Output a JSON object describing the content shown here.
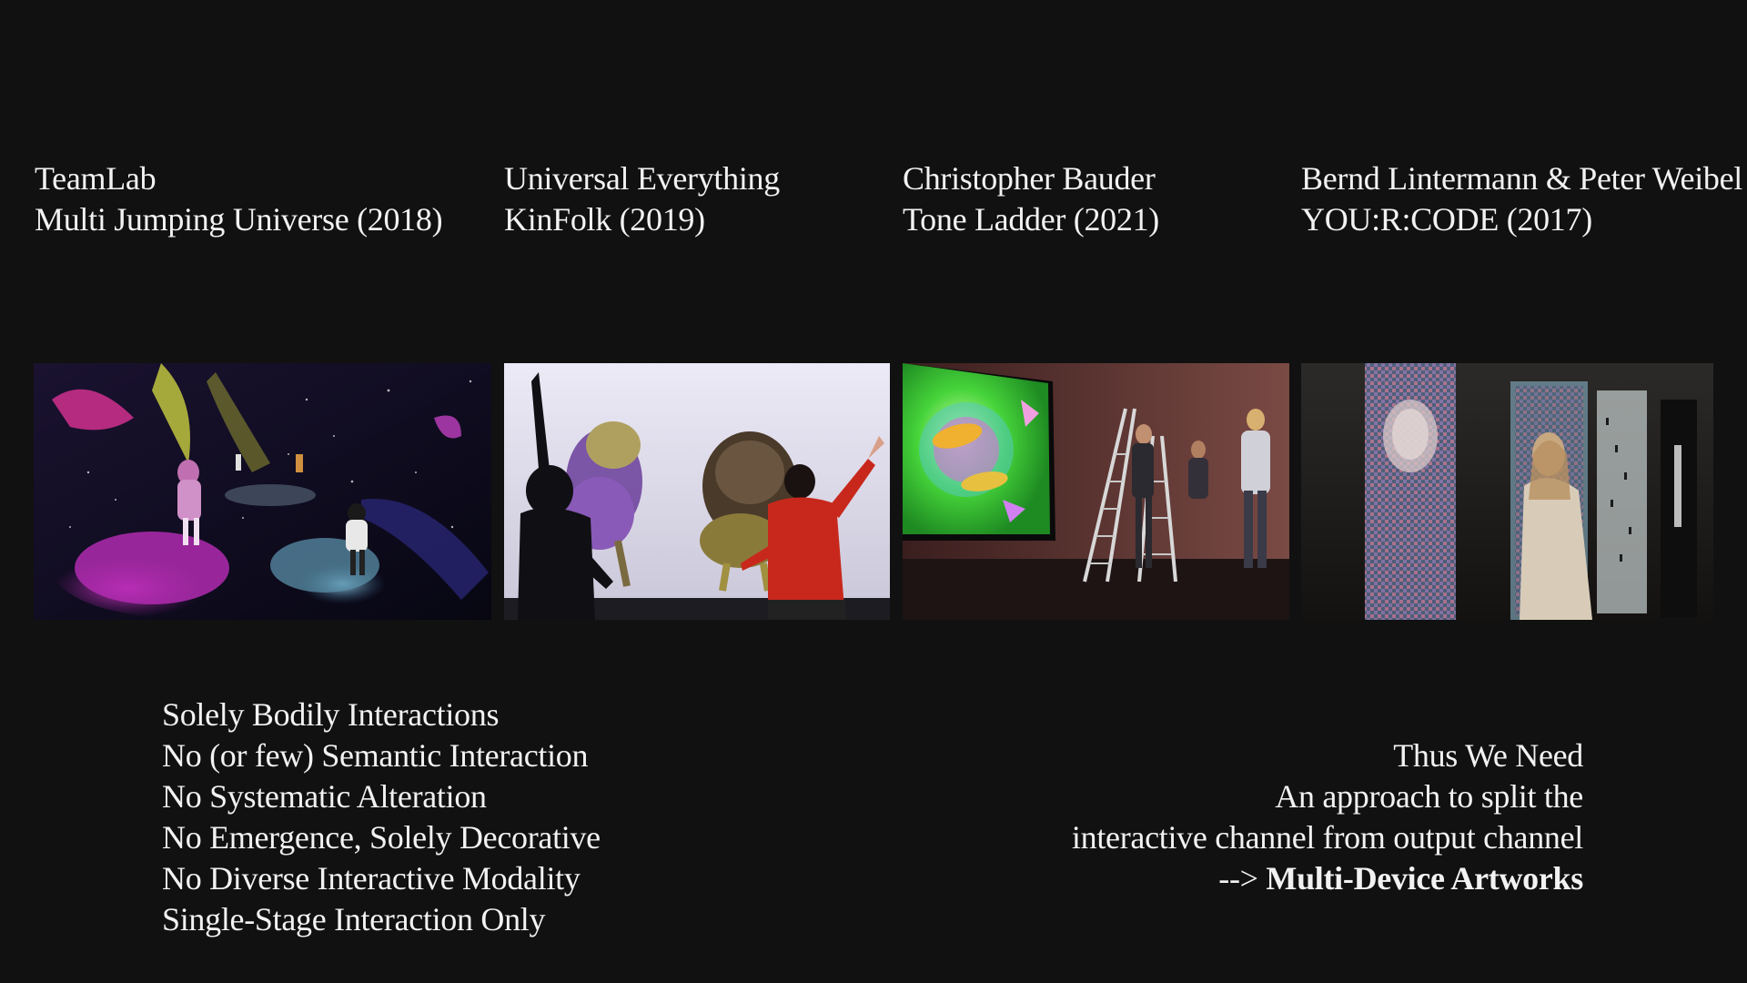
{
  "artworks": [
    {
      "artist": "TeamLab",
      "title": "Multi Jumping Universe (2018)"
    },
    {
      "artist": "Universal Everything",
      "title": "KinFolk (2019)"
    },
    {
      "artist": "Christopher Bauder",
      "title": "Tone Ladder (2021)"
    },
    {
      "artist": "Bernd Lintermann & Peter Weibel",
      "title": "YOU:R:CODE (2017)"
    }
  ],
  "critique": [
    "Solely Bodily Interactions",
    "No (or few) Semantic Interaction",
    "No Systematic Alteration",
    "No Emergence, Solely Decorative",
    "No Diverse Interactive Modality",
    "Single-Stage Interaction Only"
  ],
  "conclusion": {
    "line1": "Thus We Need",
    "line2": "An approach to split the",
    "line3": "interactive channel from output channel",
    "arrow": "-->",
    "highlight": "Multi-Device Artworks"
  },
  "colors": {
    "background": "#111111",
    "text": "#f2f2f2"
  }
}
